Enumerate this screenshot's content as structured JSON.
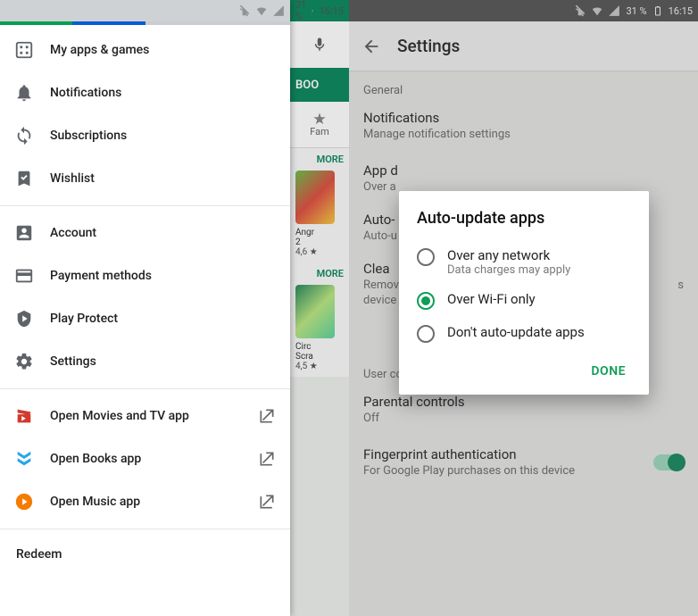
{
  "status": {
    "battery": "31 %",
    "time": "16:15"
  },
  "drawer": {
    "section1": [
      {
        "icon": "apps-grid-icon",
        "label": "My apps & games"
      },
      {
        "icon": "bell-icon",
        "label": "Notifications"
      },
      {
        "icon": "refresh-icon",
        "label": "Subscriptions"
      },
      {
        "icon": "bookmark-check-icon",
        "label": "Wishlist"
      }
    ],
    "section2": [
      {
        "icon": "account-box-icon",
        "label": "Account"
      },
      {
        "icon": "credit-card-icon",
        "label": "Payment methods"
      },
      {
        "icon": "shield-play-icon",
        "label": "Play Protect"
      },
      {
        "icon": "gear-icon",
        "label": "Settings"
      }
    ],
    "section3": [
      {
        "icon": "movies-icon",
        "label": "Open Movies and TV app",
        "color": "#d13b2e"
      },
      {
        "icon": "books-icon",
        "label": "Open Books app",
        "color": "#29a7e8"
      },
      {
        "icon": "music-icon",
        "label": "Open Music app",
        "color": "#f57c00"
      }
    ],
    "redeem": "Redeem"
  },
  "peek": {
    "tab_partial": "BOO",
    "category_partial": "Fam",
    "more": "MORE",
    "card1": {
      "title_line1": "Angr",
      "title_line2": "2",
      "rating": "4,6 ★"
    },
    "card2": {
      "title_line1": "Circ",
      "title_line2": "Scra",
      "rating": "4,5 ★"
    }
  },
  "settings": {
    "title": "Settings",
    "general_header": "General",
    "rows": {
      "notifications": {
        "primary": "Notifications",
        "secondary": "Manage notification settings"
      },
      "app_download": {
        "primary": "App d",
        "secondary": "Over a"
      },
      "auto_update": {
        "primary": "Auto-",
        "secondary": "Auto-u"
      },
      "clear": {
        "primary": "Clea",
        "secondary_line1": "Remov",
        "secondary_line2": "device"
      },
      "user_controls_header": "User controls",
      "parental": {
        "primary": "Parental controls",
        "secondary": "Off"
      },
      "fingerprint": {
        "primary": "Fingerprint authentication",
        "secondary": "For Google Play purchases on this device"
      },
      "trailing_s": "s"
    }
  },
  "dialog": {
    "title": "Auto-update apps",
    "options": [
      {
        "label": "Over any network",
        "sub": "Data charges may apply",
        "selected": false
      },
      {
        "label": "Over Wi-Fi only",
        "sub": "",
        "selected": true
      },
      {
        "label": "Don't auto-update apps",
        "sub": "",
        "selected": false
      }
    ],
    "done": "DONE"
  }
}
